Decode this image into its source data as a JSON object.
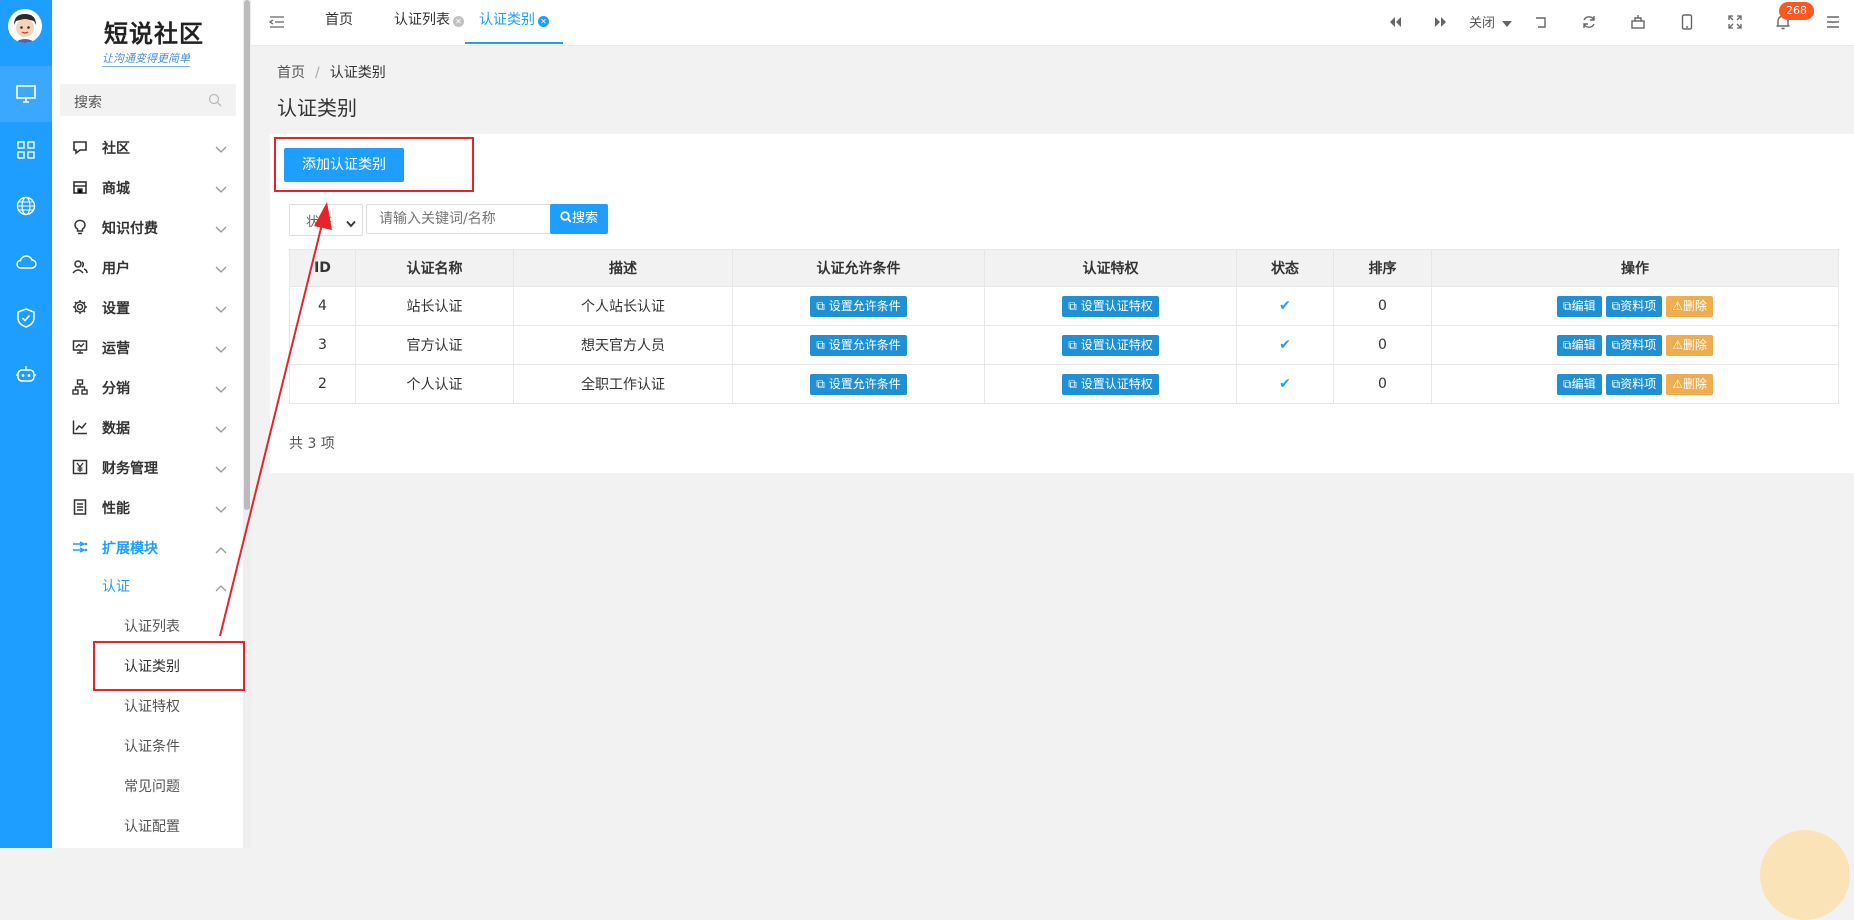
{
  "logo": {
    "title": "短说社区",
    "subtitle": "让沟通变得更简单"
  },
  "sidebar": {
    "search_placeholder": "搜索",
    "menu": [
      {
        "label": "社区",
        "icon": "chat-icon"
      },
      {
        "label": "商城",
        "icon": "store-icon"
      },
      {
        "label": "知识付费",
        "icon": "bulb-icon"
      },
      {
        "label": "用户",
        "icon": "users-icon"
      },
      {
        "label": "设置",
        "icon": "gear-icon"
      },
      {
        "label": "运营",
        "icon": "monitor-chart-icon"
      },
      {
        "label": "分销",
        "icon": "hierarchy-icon"
      },
      {
        "label": "数据",
        "icon": "line-chart-icon"
      },
      {
        "label": "财务管理",
        "icon": "yen-icon"
      },
      {
        "label": "性能",
        "icon": "list-icon"
      },
      {
        "label": "扩展模块",
        "icon": "extension-icon"
      }
    ],
    "submenu_group": "认证",
    "submenu": [
      "认证列表",
      "认证类别",
      "认证特权",
      "认证条件",
      "常见问题",
      "认证配置"
    ]
  },
  "tabs": [
    {
      "label": "首页"
    },
    {
      "label": "认证列表"
    },
    {
      "label": "认证类别"
    }
  ],
  "toolbar": {
    "close_label": "关闭",
    "notifications": "268"
  },
  "breadcrumb": {
    "home": "首页",
    "current": "认证类别"
  },
  "page_title": "认证类别",
  "add_button": "添加认证类别",
  "filter": {
    "status_value": "状态",
    "keyword_placeholder": "请输入关键词/名称",
    "search_label": "搜索"
  },
  "table": {
    "headers": [
      "ID",
      "认证名称",
      "描述",
      "认证允许条件",
      "认证特权",
      "状态",
      "排序",
      "操作"
    ],
    "rows": [
      {
        "id": "4",
        "name": "站长认证",
        "desc": "个人站长认证",
        "cond_btn": "设置允许条件",
        "priv_btn": "设置认证特权",
        "sort": "0"
      },
      {
        "id": "3",
        "name": "官方认证",
        "desc": "想天官方人员",
        "cond_btn": "设置允许条件",
        "priv_btn": "设置认证特权",
        "sort": "0"
      },
      {
        "id": "2",
        "name": "个人认证",
        "desc": "全职工作认证",
        "cond_btn": "设置允许条件",
        "priv_btn": "设置认证特权",
        "sort": "0"
      }
    ],
    "actions": {
      "edit": "编辑",
      "profile": "资料项",
      "delete": "删除"
    },
    "total": "共 3 项"
  },
  "colors": {
    "accent": "#1e9fff",
    "warning": "#f0ad4e",
    "annotation": "#e8242b"
  }
}
